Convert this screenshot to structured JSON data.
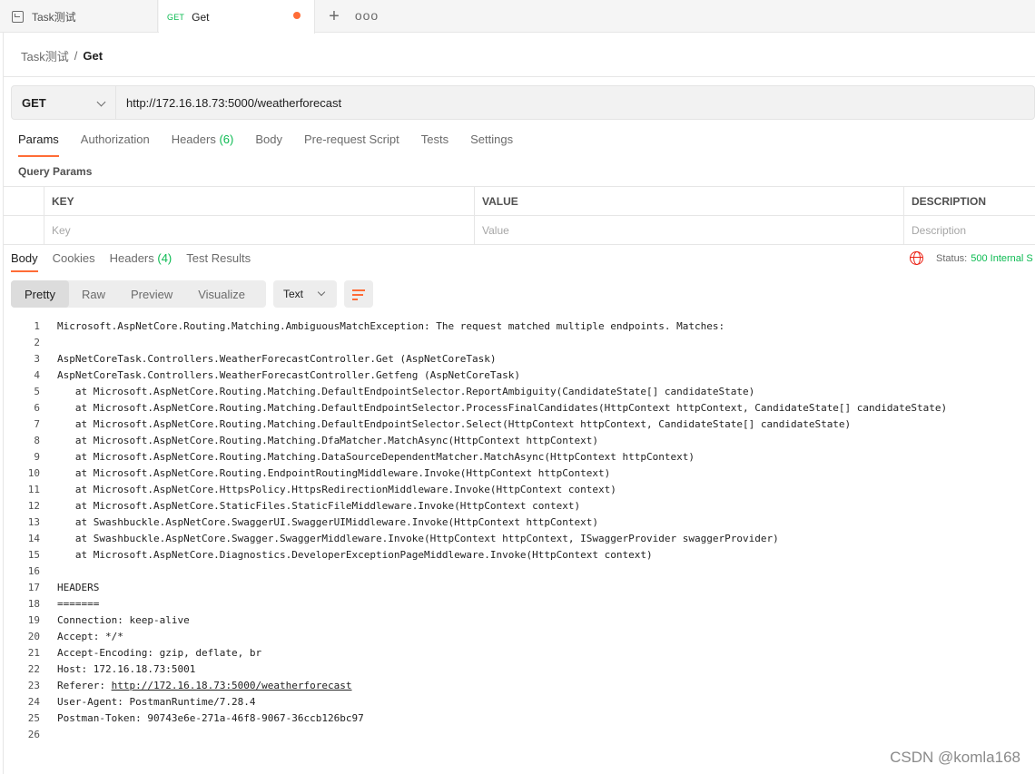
{
  "tabs": [
    {
      "title": "Task测试",
      "method": ""
    },
    {
      "title": "Get",
      "method": "GET",
      "unsaved": true
    }
  ],
  "breadcrumb": {
    "parent": "Task测试",
    "separator": "/",
    "current": "Get"
  },
  "request": {
    "method": "GET",
    "url": "http://172.16.18.73:5000/weatherforecast",
    "tabs": {
      "params": "Params",
      "authorization": "Authorization",
      "headers": "Headers",
      "headers_count": "(6)",
      "body": "Body",
      "prerequest": "Pre-request Script",
      "tests": "Tests",
      "settings": "Settings"
    },
    "query_params_title": "Query Params",
    "table": {
      "columns": [
        "KEY",
        "VALUE",
        "DESCRIPTION"
      ],
      "placeholders": [
        "Key",
        "Value",
        "Description"
      ]
    }
  },
  "response": {
    "tabs": {
      "body": "Body",
      "cookies": "Cookies",
      "headers": "Headers",
      "headers_count": "(4)",
      "test_results": "Test Results"
    },
    "status_label": "Status:",
    "status_value": "500 Internal S",
    "view_modes": [
      "Pretty",
      "Raw",
      "Preview",
      "Visualize"
    ],
    "format": "Text",
    "lines": [
      "Microsoft.AspNetCore.Routing.Matching.AmbiguousMatchException: The request matched multiple endpoints. Matches:",
      "",
      "AspNetCoreTask.Controllers.WeatherForecastController.Get (AspNetCoreTask)",
      "AspNetCoreTask.Controllers.WeatherForecastController.Getfeng (AspNetCoreTask)",
      "   at Microsoft.AspNetCore.Routing.Matching.DefaultEndpointSelector.ReportAmbiguity(CandidateState[] candidateState)",
      "   at Microsoft.AspNetCore.Routing.Matching.DefaultEndpointSelector.ProcessFinalCandidates(HttpContext httpContext, CandidateState[] candidateState)",
      "   at Microsoft.AspNetCore.Routing.Matching.DefaultEndpointSelector.Select(HttpContext httpContext, CandidateState[] candidateState)",
      "   at Microsoft.AspNetCore.Routing.Matching.DfaMatcher.MatchAsync(HttpContext httpContext)",
      "   at Microsoft.AspNetCore.Routing.Matching.DataSourceDependentMatcher.MatchAsync(HttpContext httpContext)",
      "   at Microsoft.AspNetCore.Routing.EndpointRoutingMiddleware.Invoke(HttpContext httpContext)",
      "   at Microsoft.AspNetCore.HttpsPolicy.HttpsRedirectionMiddleware.Invoke(HttpContext context)",
      "   at Microsoft.AspNetCore.StaticFiles.StaticFileMiddleware.Invoke(HttpContext context)",
      "   at Swashbuckle.AspNetCore.SwaggerUI.SwaggerUIMiddleware.Invoke(HttpContext httpContext)",
      "   at Swashbuckle.AspNetCore.Swagger.SwaggerMiddleware.Invoke(HttpContext httpContext, ISwaggerProvider swaggerProvider)",
      "   at Microsoft.AspNetCore.Diagnostics.DeveloperExceptionPageMiddleware.Invoke(HttpContext context)",
      "",
      "HEADERS",
      "=======",
      "Connection: keep-alive",
      "Accept: */*",
      "Accept-Encoding: gzip, deflate, br",
      "Host: 172.16.18.73:5001",
      "Referer: ",
      "User-Agent: PostmanRuntime/7.28.4",
      "Postman-Token: 90743e6e-271a-46f8-9067-36ccb126bc97",
      ""
    ],
    "referer_link": "http://172.16.18.73:5000/weatherforecast"
  },
  "watermark": "CSDN @komla168",
  "colors": {
    "accent": "#ff6c37",
    "success": "#0cbb52",
    "error": "#eb2013"
  }
}
